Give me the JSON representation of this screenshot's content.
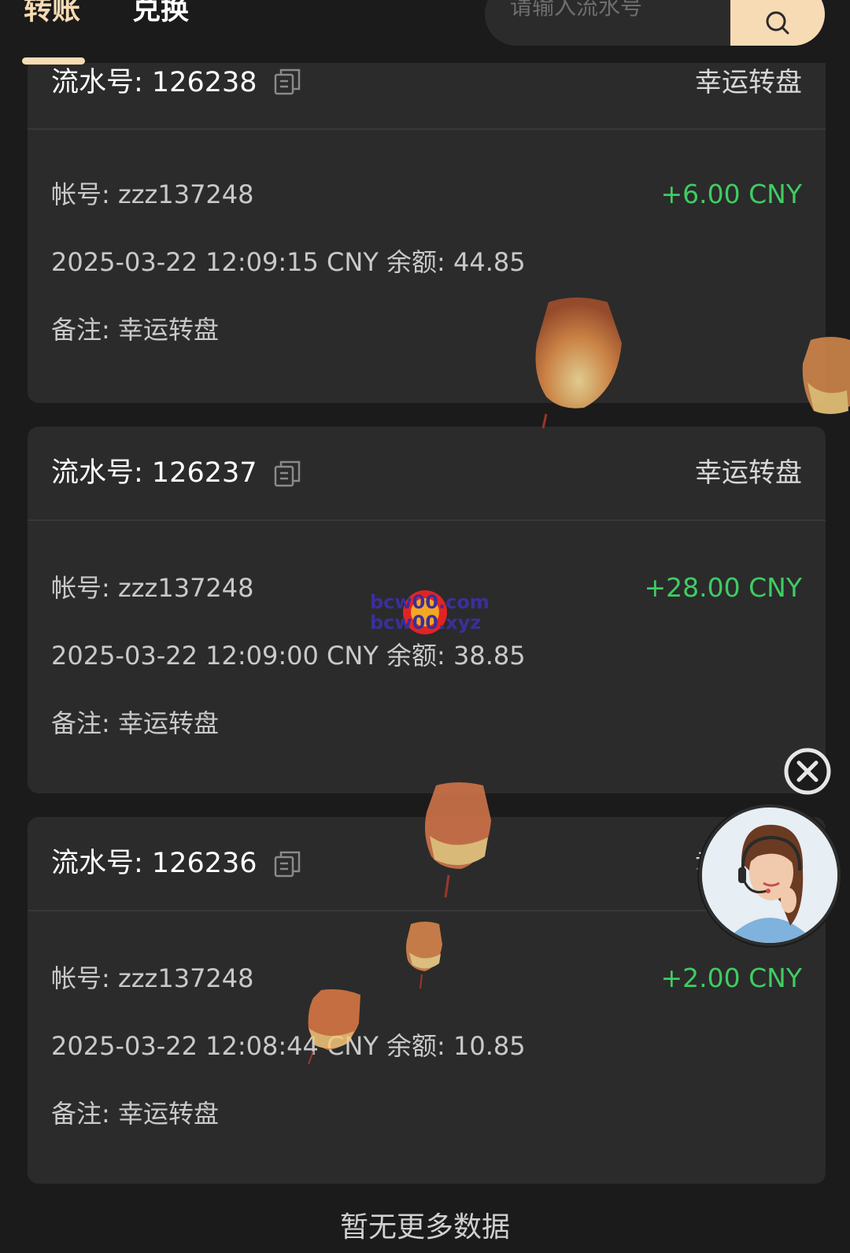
{
  "tabs": [
    {
      "label": "转账",
      "active": true
    },
    {
      "label": "兑换",
      "active": false
    }
  ],
  "search": {
    "placeholder": "请输入流水号",
    "value": ""
  },
  "records": [
    {
      "serial_label": "流水号: 126238",
      "type": "幸运转盘",
      "account": "帐号: zzz137248",
      "amount": "+6.00 CNY",
      "time_balance": "2025-03-22 12:09:15 CNY 余额: 44.85",
      "note": "备注: 幸运转盘"
    },
    {
      "serial_label": "流水号: 126237",
      "type": "幸运转盘",
      "account": "帐号: zzz137248",
      "amount": "+28.00 CNY",
      "time_balance": "2025-03-22 12:09:00 CNY 余额: 38.85",
      "note": "备注: 幸运转盘"
    },
    {
      "serial_label": "流水号: 126236",
      "type": "幸运转盘",
      "account": "帐号: zzz137248",
      "amount": "+2.00 CNY",
      "time_balance": "2025-03-22 12:08:44 CNY 余额: 10.85",
      "note": "备注: 幸运转盘"
    }
  ],
  "footer": {
    "no_more": "暂无更多数据"
  },
  "watermark": {
    "line1": "bcw00.com",
    "line2": "bcw00.xyz"
  },
  "colors": {
    "accent": "#f7dbb4",
    "positive": "#3fcc63",
    "card_bg": "#2b2b2b",
    "page_bg": "#1b1b1b"
  },
  "icons": {
    "copy": "copy-icon",
    "search": "search-icon",
    "close": "close-icon"
  }
}
